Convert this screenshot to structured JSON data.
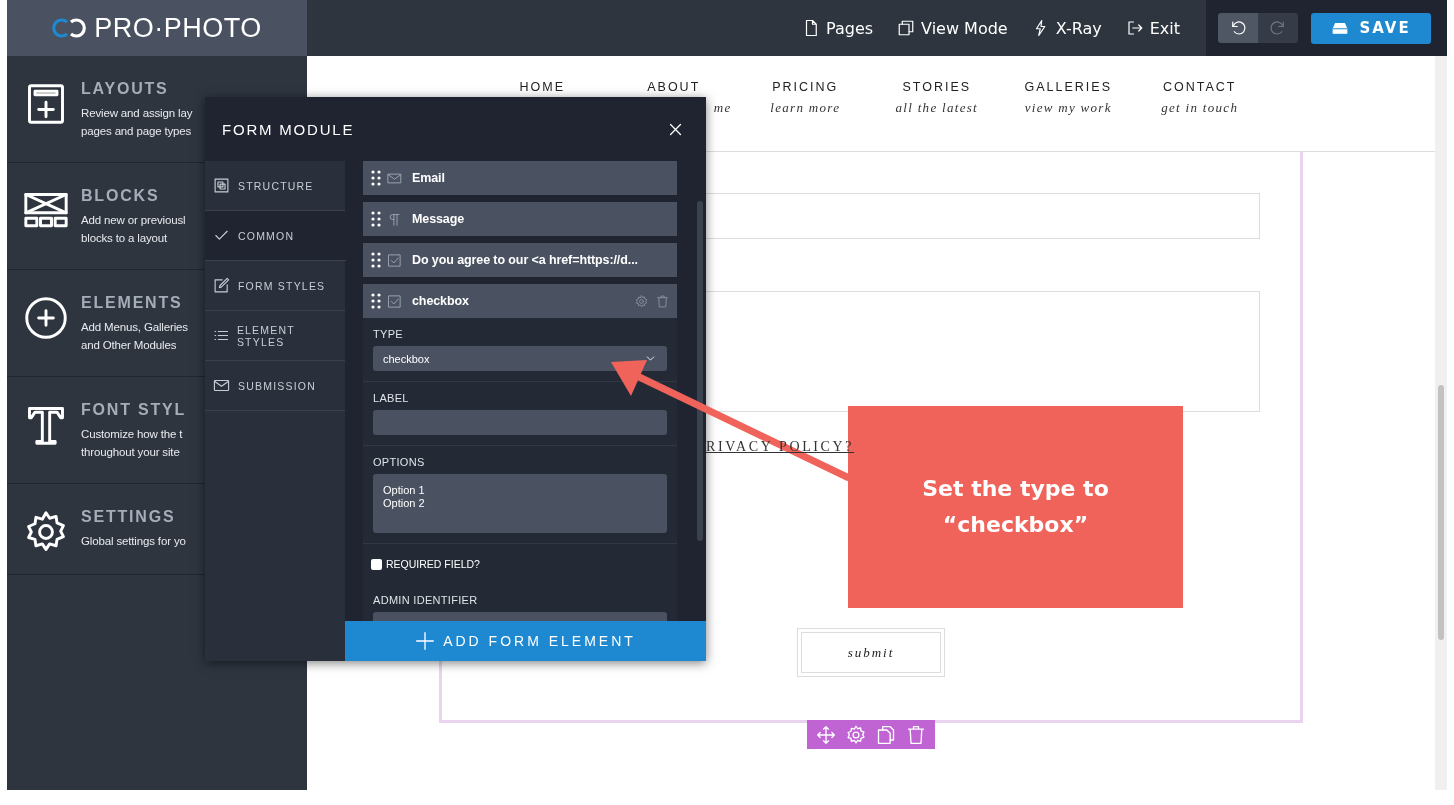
{
  "topbar": {
    "logo": "PRO·PHOTO",
    "actions": [
      {
        "kind": "pages",
        "label": "Pages"
      },
      {
        "kind": "view",
        "label": "View Mode"
      },
      {
        "kind": "xray",
        "label": "X-Ray"
      },
      {
        "kind": "exit",
        "label": "Exit"
      }
    ],
    "history": [
      {
        "kind": "undo",
        "disabled": false
      },
      {
        "kind": "redo",
        "disabled": true
      }
    ],
    "save": "SAVE"
  },
  "sidebar": {
    "items": [
      {
        "kind": "layouts",
        "title": "LAYOUTS",
        "lines": [
          "Review and assign lay",
          "pages and page types"
        ]
      },
      {
        "kind": "blocks",
        "title": "BLOCKS",
        "lines": [
          "Add new or previousl",
          "blocks to a layout"
        ]
      },
      {
        "kind": "elements",
        "title": "ELEMENTS",
        "lines": [
          "Add Menus, Galleries",
          "and Other Modules"
        ]
      },
      {
        "kind": "fonts",
        "title": "FONT STYL",
        "lines": [
          "Customize how the t",
          "throughout your site"
        ]
      },
      {
        "kind": "settings",
        "title": "SETTINGS",
        "lines": [
          "Global settings for yo"
        ]
      }
    ]
  },
  "site_nav": [
    {
      "title": "HOME"
    },
    {
      "title": "ABOUT",
      "subtitle": "me"
    },
    {
      "title": "PRICING",
      "subtitle": "learn more"
    },
    {
      "title": "STORIES",
      "subtitle": "all the latest"
    },
    {
      "title": "GALLERIES",
      "subtitle": "view my work"
    },
    {
      "title": "CONTACT",
      "subtitle": "get in touch"
    }
  ],
  "form_block": {
    "privacy_link": "RIVACY POLICY?",
    "submit": "submit",
    "toolbar": [
      {
        "kind": "move"
      },
      {
        "kind": "settings"
      },
      {
        "kind": "copy"
      },
      {
        "kind": "delete"
      }
    ]
  },
  "modal": {
    "title": "FORM MODULE",
    "tabs": [
      {
        "kind": "structure",
        "label": "STRUCTURE",
        "selected": false
      },
      {
        "kind": "common",
        "label": "COMMON",
        "selected": true
      },
      {
        "kind": "styles",
        "label": "FORM STYLES",
        "selected": false
      },
      {
        "kind": "elements",
        "label": "ELEMENT STYLES",
        "selected": false
      },
      {
        "kind": "submission",
        "label": "SUBMISSION",
        "selected": false
      }
    ],
    "fields": [
      {
        "kind": "email",
        "label": "Email",
        "expanded": false
      },
      {
        "kind": "message",
        "label": "Message",
        "expanded": false
      },
      {
        "kind": "checkbox",
        "label": "Do you agree to our <a href=https://d...",
        "expanded": false
      },
      {
        "kind": "checkbox",
        "label": "checkbox",
        "expanded": true
      }
    ],
    "details": {
      "type_label": "TYPE",
      "type_value": "checkbox",
      "label_label": "LABEL",
      "options_label": "OPTIONS",
      "options_value": "Option 1\nOption 2",
      "required": {
        "label": "REQUIRED FIELD?",
        "checked": false
      },
      "admin_label": "ADMIN IDENTIFIER"
    },
    "add_button": "ADD FORM ELEMENT"
  },
  "callout": {
    "text": "Set the type to “checkbox”"
  }
}
